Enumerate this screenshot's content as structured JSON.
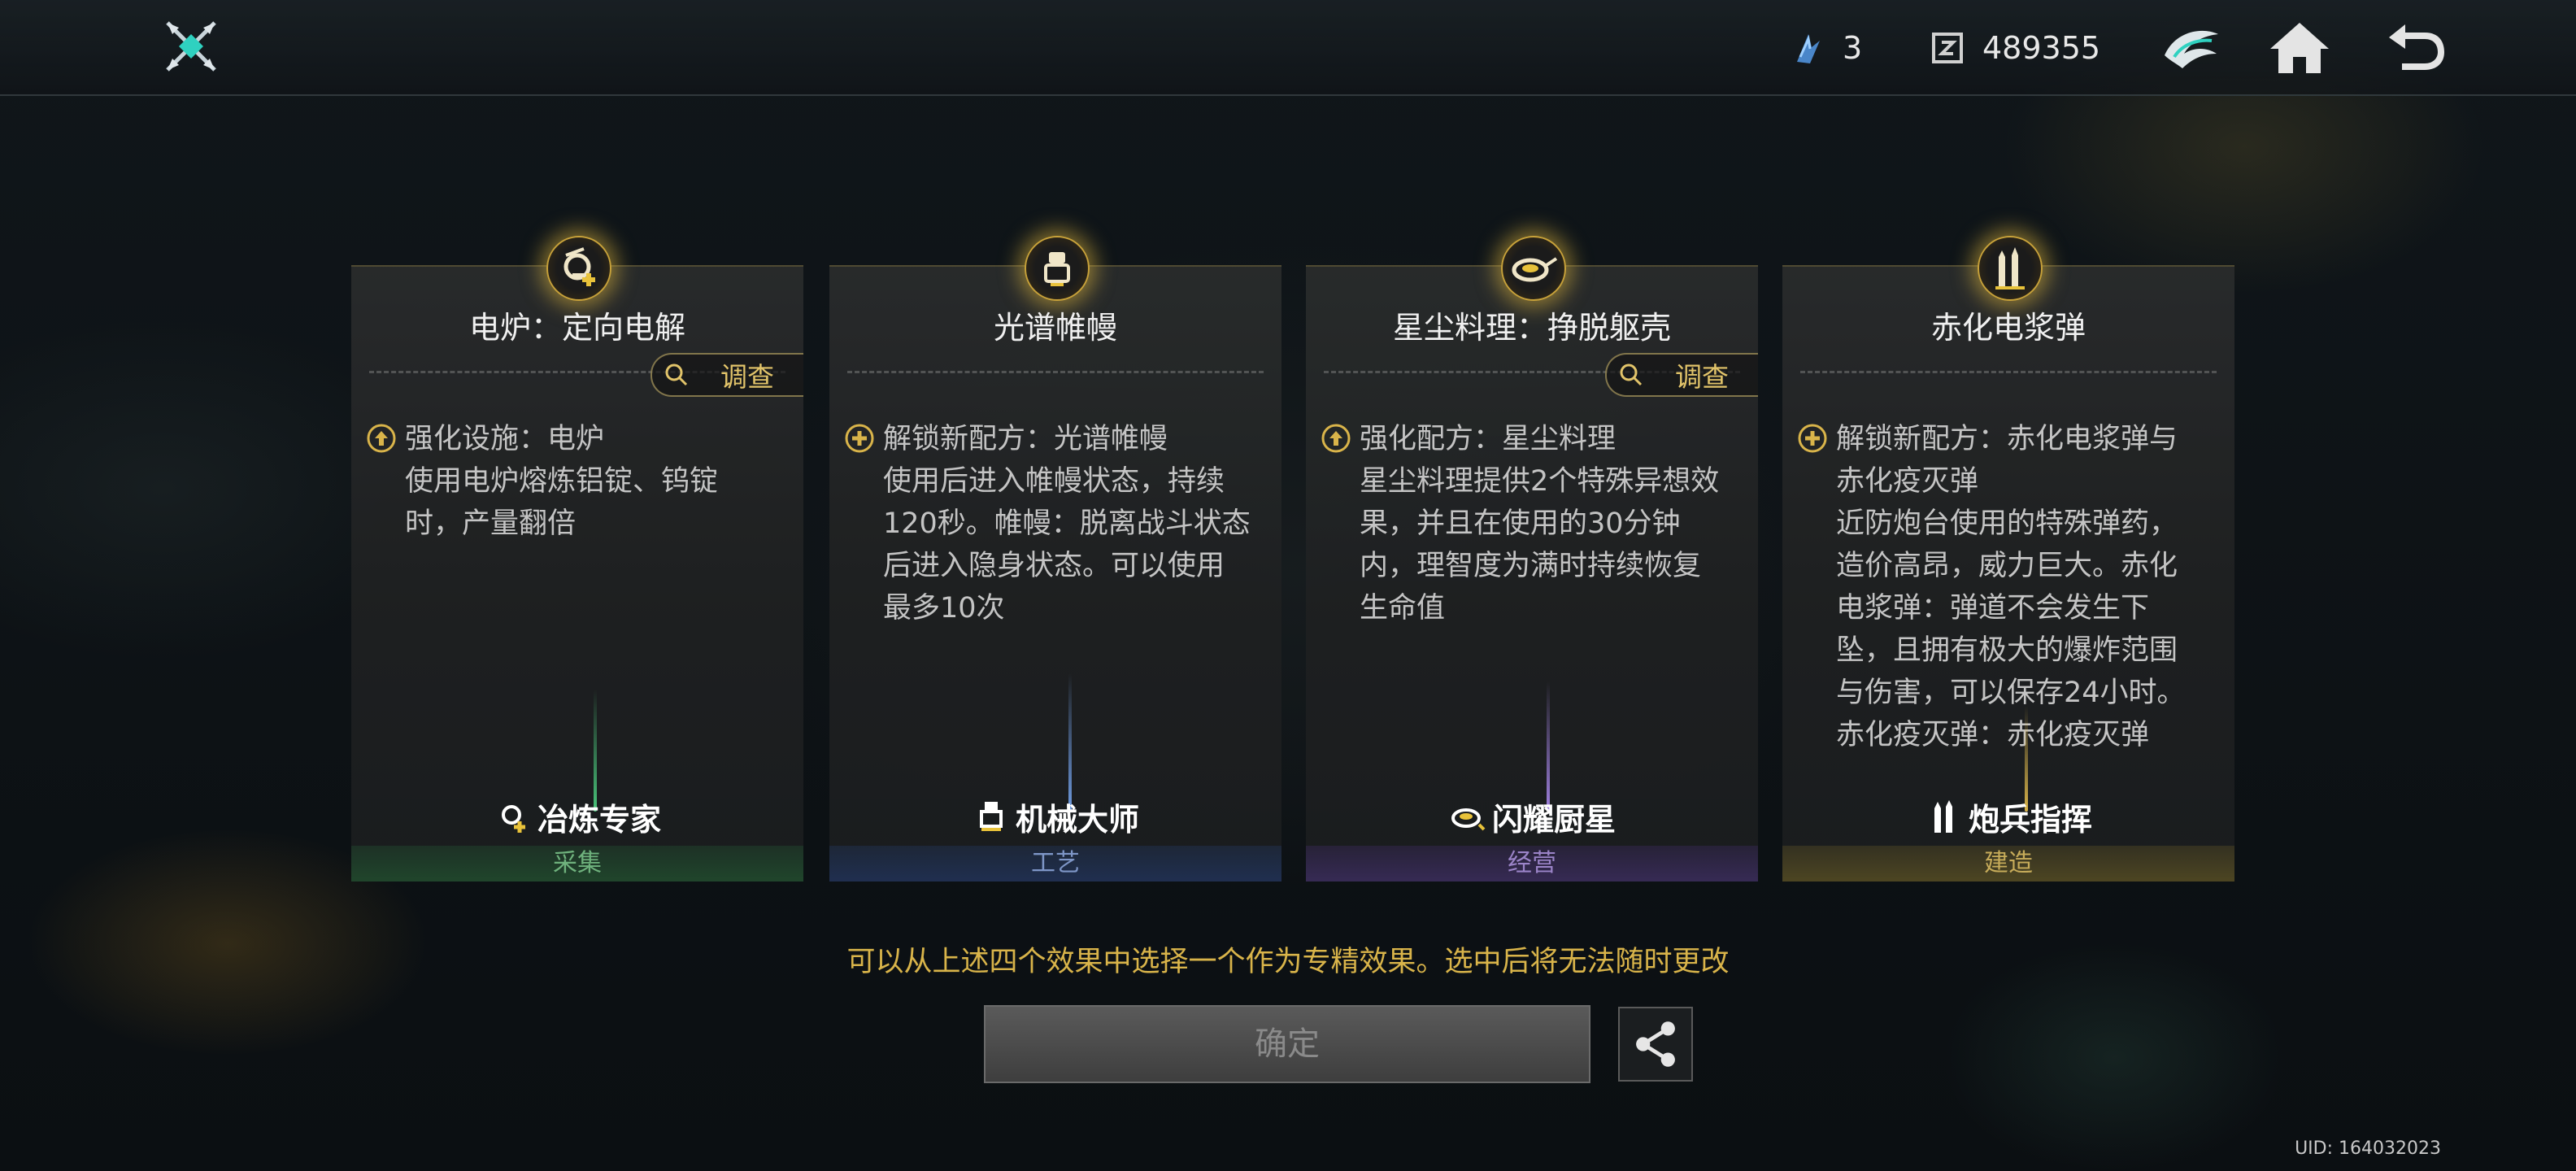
{
  "header": {
    "resources": [
      {
        "icon": "crystal-shard-icon",
        "value": "3"
      },
      {
        "icon": "currency-chip-icon",
        "value": "489355"
      }
    ]
  },
  "cards": [
    {
      "icon": "furnace-icon",
      "title": "电炉：定向电解",
      "survey_label": "调查",
      "effect_head": "强化设施：电炉",
      "effect_body": "使用电炉熔炼铝锭、钨锭时，产量翻倍",
      "specialization": "冶炼专家",
      "category": "采集"
    },
    {
      "icon": "robot-icon",
      "title": "光谱帷幔",
      "survey_label": "",
      "effect_head": "解锁新配方：光谱帷幔",
      "effect_body": "使用后进入帷幔状态，持续120秒。帷幔：脱离战斗状态后进入隐身状态。可以使用最多10次",
      "specialization": "机械大师",
      "category": "工艺"
    },
    {
      "icon": "dish-icon",
      "title": "星尘料理：挣脱躯壳",
      "survey_label": "调查",
      "effect_head": "强化配方：星尘料理",
      "effect_body": "星尘料理提供2个特殊异想效果，并且在使用的30分钟内，理智度为满时持续恢复生命值",
      "specialization": "闪耀厨星",
      "category": "经营"
    },
    {
      "icon": "shells-icon",
      "title": "赤化电浆弹",
      "survey_label": "",
      "effect_head": "解锁新配方：赤化电浆弹与赤化疫灭弹",
      "effect_body": "近防炮台使用的特殊弹药，造价高昂，威力巨大。赤化电浆弹：弹道不会发生下坠，且拥有极大的爆炸范围与伤害，可以保存24小时。赤化疫灭弹：赤化疫灭弹",
      "specialization": "炮兵指挥",
      "category": "建造"
    }
  ],
  "notice": "可以从上述四个效果中选择一个作为专精效果。选中后将无法随时更改",
  "confirm_label": "确定",
  "uid": "UID: 164032023",
  "colors": {
    "accent_gold": "#d9b44a",
    "gather_green": "#6fb27d",
    "craft_blue": "#7e96c7",
    "manage_purple": "#9b84c8",
    "build_gold": "#c7ac5a"
  }
}
